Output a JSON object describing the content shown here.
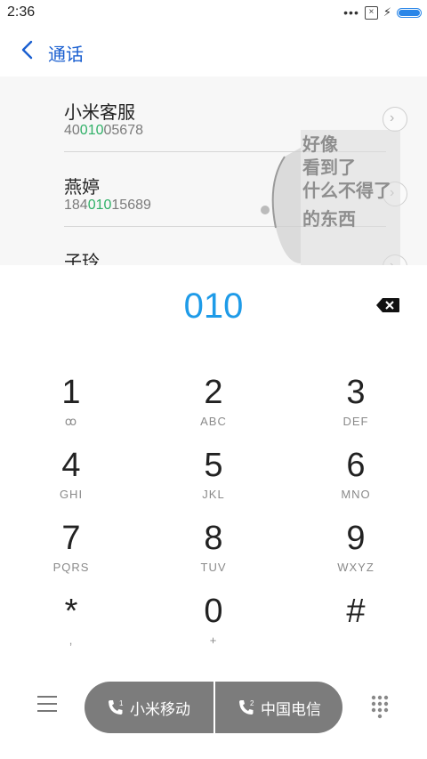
{
  "status": {
    "time": "2:36",
    "more": "•••",
    "sim_box": "×"
  },
  "header": {
    "title": "通话"
  },
  "results": [
    {
      "name": "小米客服",
      "num_pre": "40",
      "num_hl": "010",
      "num_post": "05678"
    },
    {
      "name": "燕婷",
      "num_pre": "184",
      "num_hl": "010",
      "num_post": "15689"
    },
    {
      "name": "子玲",
      "num_pre": "",
      "num_hl": "",
      "num_post": ""
    }
  ],
  "meme": {
    "lines": [
      "好像",
      "看到了",
      "什么不得了",
      "的东西"
    ]
  },
  "input": {
    "digits": "010"
  },
  "keypad": [
    {
      "n": "1",
      "l": ""
    },
    {
      "n": "2",
      "l": "ABC"
    },
    {
      "n": "3",
      "l": "DEF"
    },
    {
      "n": "4",
      "l": "GHI"
    },
    {
      "n": "5",
      "l": "JKL"
    },
    {
      "n": "6",
      "l": "MNO"
    },
    {
      "n": "7",
      "l": "PQRS"
    },
    {
      "n": "8",
      "l": "TUV"
    },
    {
      "n": "9",
      "l": "WXYZ"
    },
    {
      "n": "*",
      "l": ","
    },
    {
      "n": "0",
      "l": "+"
    },
    {
      "n": "#",
      "l": ""
    }
  ],
  "bottom": {
    "sim1_label": "小米移动",
    "sim1_index": "1",
    "sim2_label": "中国电信",
    "sim2_index": "2"
  },
  "colors": {
    "accent": "#1e9be8",
    "match": "#2fb067",
    "title": "#1a5fd0",
    "pill": "#7c7c7c"
  }
}
